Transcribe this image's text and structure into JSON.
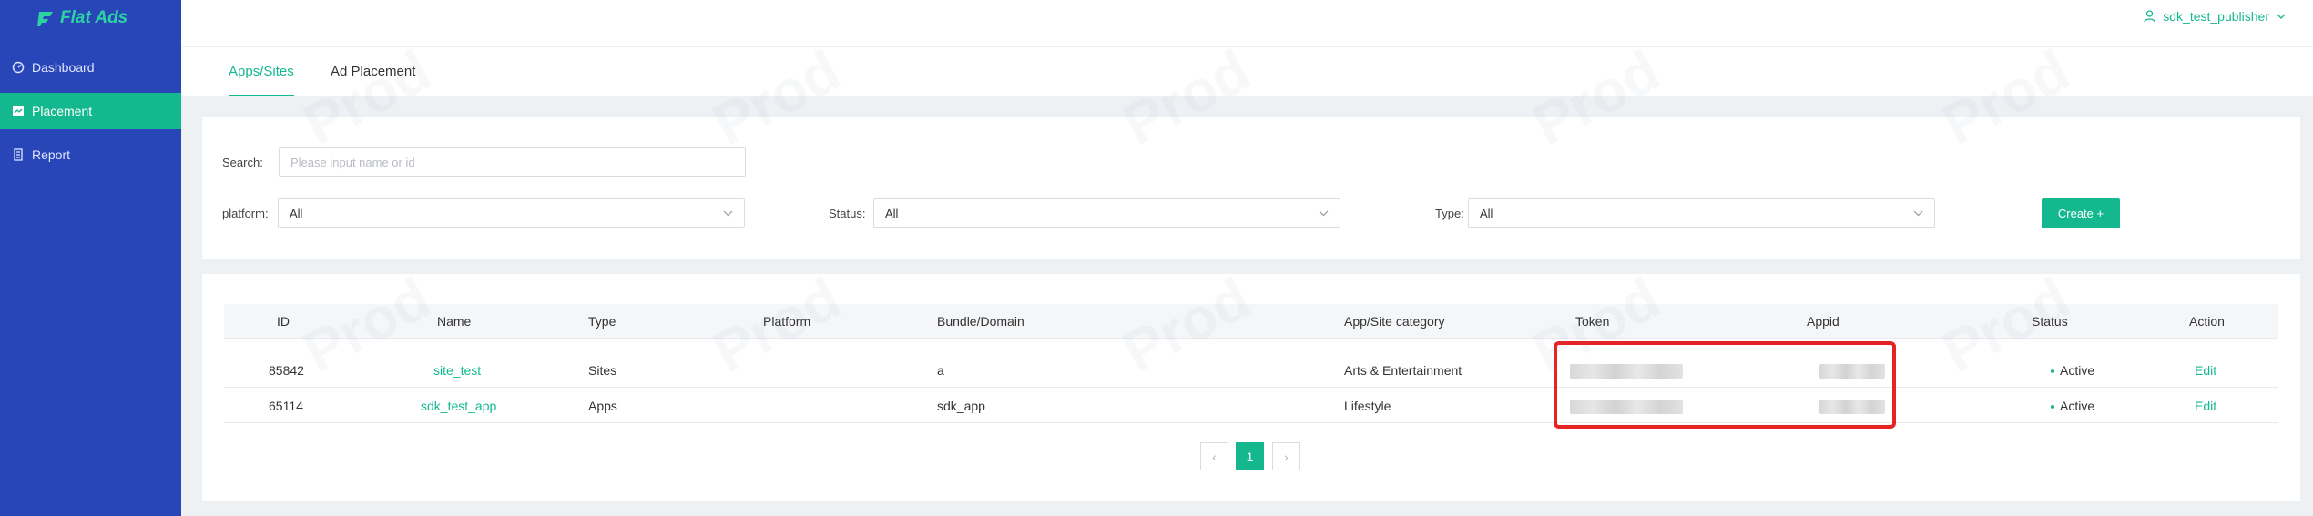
{
  "app": {
    "logo_text": "Flat Ads"
  },
  "sidebar": {
    "items": [
      {
        "label": "Dashboard",
        "icon": "dashboard-icon",
        "active": false
      },
      {
        "label": "Placement",
        "icon": "placement-icon",
        "active": true
      },
      {
        "label": "Report",
        "icon": "report-icon",
        "active": false
      }
    ]
  },
  "header": {
    "user": "sdk_test_publisher"
  },
  "tabs": [
    {
      "label": "Apps/Sites",
      "active": true
    },
    {
      "label": "Ad Placement",
      "active": false
    }
  ],
  "filters": {
    "search_label": "Search:",
    "search_placeholder": "Please input name or id",
    "platform_label": "platform:",
    "platform_value": "All",
    "status_label": "Status:",
    "status_value": "All",
    "type_label": "Type:",
    "type_value": "All",
    "create_label": "Create +"
  },
  "table": {
    "columns": [
      "ID",
      "Name",
      "Type",
      "Platform",
      "Bundle/Domain",
      "App/Site category",
      "Token",
      "Appid",
      "Status",
      "Action"
    ],
    "rows": [
      {
        "id": "85842",
        "name": "site_test",
        "type": "Sites",
        "platform": "",
        "bundle": "a",
        "category": "Arts & Entertainment",
        "status": "Active",
        "action": "Edit"
      },
      {
        "id": "65114",
        "name": "sdk_test_app",
        "type": "Apps",
        "platform": "",
        "bundle": "sdk_app",
        "category": "Lifestyle",
        "status": "Active",
        "action": "Edit"
      }
    ]
  },
  "pagination": {
    "current": "1",
    "prev": "‹",
    "next": "›"
  },
  "watermark": "Prod",
  "colors": {
    "sidebar": "#2946b9",
    "accent": "#14b88f",
    "highlight": "#e62323"
  }
}
